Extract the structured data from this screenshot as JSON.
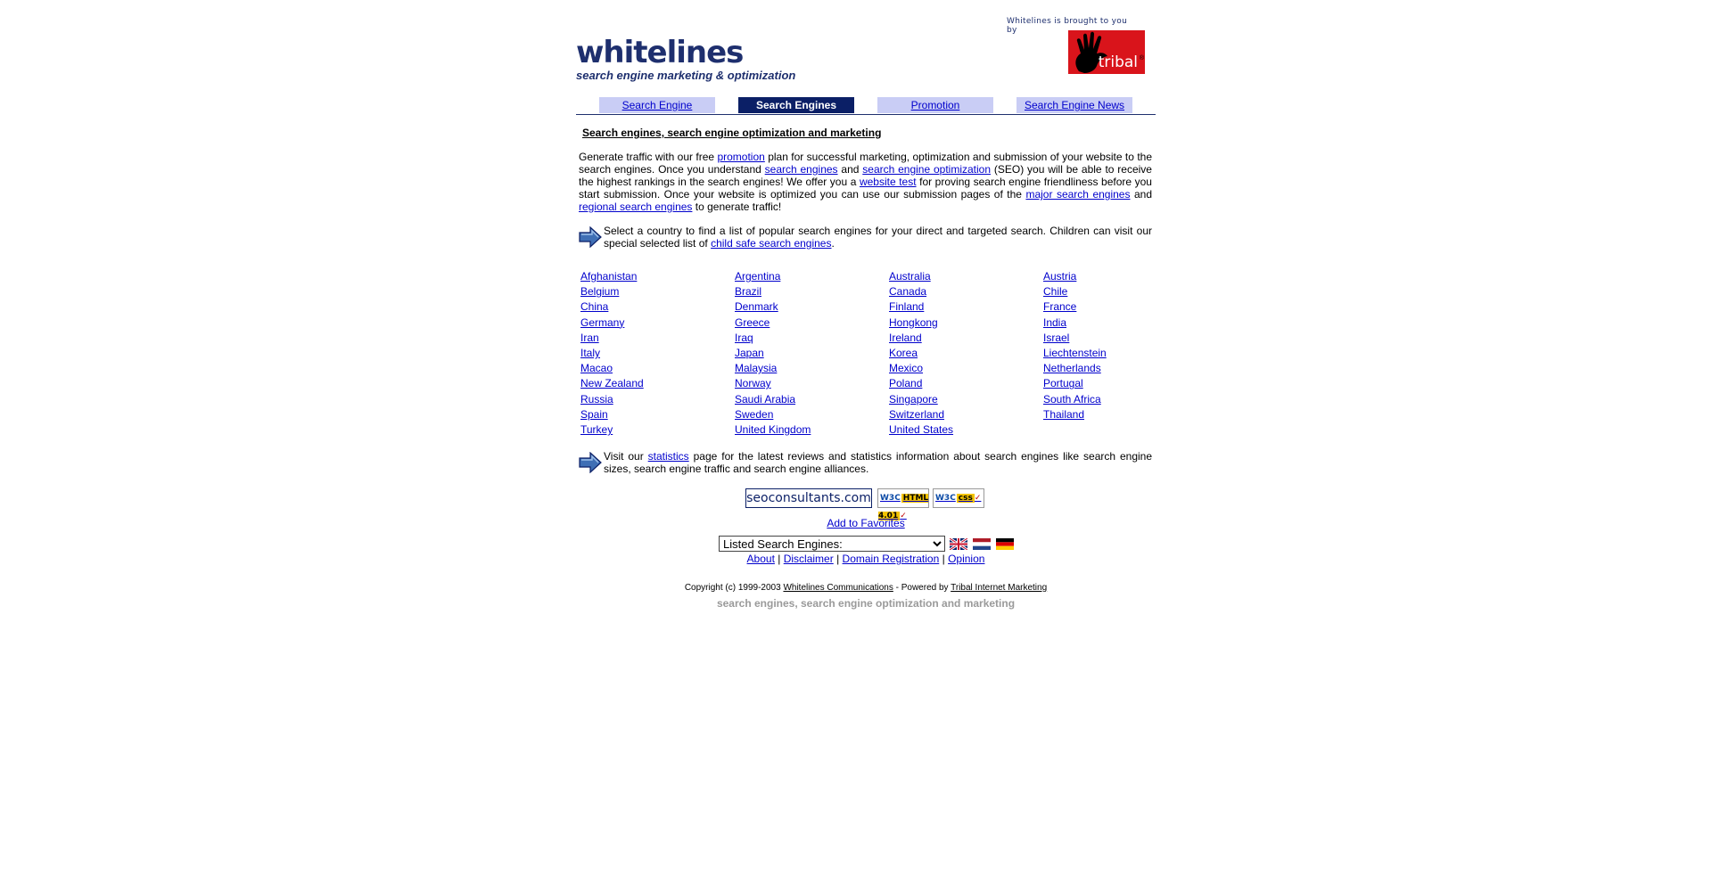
{
  "brand": {
    "name": "whitelines",
    "tagline": "search engine marketing & optimization",
    "sponsor_text": "Whitelines is brought to you by",
    "sponsor_name": "tribal",
    "sponsor_mark": "®"
  },
  "tabs": [
    {
      "label": "Search Engine",
      "active": false
    },
    {
      "label": "Search Engines",
      "active": true
    },
    {
      "label": "Promotion",
      "active": false
    },
    {
      "label": "Search Engine News",
      "active": false
    }
  ],
  "heading": "Search engines, search engine optimization and marketing",
  "intro": {
    "t1": "Generate traffic with our free ",
    "l1": "promotion",
    "t2": " plan for successful marketing, optimization and submission of your website to the search engines. Once you understand ",
    "l2": "search engines",
    "t3": " and ",
    "l3": "search engine optimization",
    "t4": " (SEO) you will be able to receive the highest rankings in the search engines! We offer you a ",
    "l4": "website test",
    "t5": " for proving search engine friendliness before you start submission. Once your website is optimized you can use our submission pages of the ",
    "l5": "major search engines",
    "t6": " and ",
    "l6": "regional search engines",
    "t7": " to generate traffic!"
  },
  "country_intro": {
    "t1": "Select a country to find a list of popular search engines for your direct and targeted search. Children can visit our special selected list of ",
    "l1": "child safe search engines",
    "t2": "."
  },
  "countries": [
    "Afghanistan",
    "Argentina",
    "Australia",
    "Austria",
    "Belgium",
    "Brazil",
    "Canada",
    "Chile",
    "China",
    "Denmark",
    "Finland",
    "France",
    "Germany",
    "Greece",
    "Hongkong",
    "India",
    "Iran",
    "Iraq",
    "Ireland",
    "Israel",
    "Italy",
    "Japan",
    "Korea",
    "Liechtenstein",
    "Macao",
    "Malaysia",
    "Mexico",
    "Netherlands",
    "New Zealand",
    "Norway",
    "Poland",
    "Portugal",
    "Russia",
    "Saudi Arabia",
    "Singapore",
    "South Africa",
    "Spain",
    "Sweden",
    "Switzerland",
    "Thailand",
    "Turkey",
    "United Kingdom",
    "United States"
  ],
  "stats_intro": {
    "t1": "Visit our ",
    "l1": "statistics",
    "t2": " page for the latest reviews and statistics information about search engines like search engine sizes, search engine traffic and search engine alliances."
  },
  "badges": {
    "seo": "seoconsultants.com",
    "w3c": "W3C",
    "html": "HTML 4.01",
    "css": "css"
  },
  "favorites": "Add to Favorites",
  "select": {
    "value": "Listed Search Engines:",
    "options": [
      "Listed Search Engines:"
    ]
  },
  "footer_links": [
    "About",
    "Disclaimer",
    "Domain Registration",
    "Opinion"
  ],
  "footer_sep": "|",
  "copyright": {
    "t1": "Copyright (c) 1999-2003 ",
    "l1": "Whitelines Communications",
    "t2": " - Powered by ",
    "l2": "Tribal Internet Marketing"
  },
  "bottom_tagline": "search engines, search engine optimization and marketing"
}
